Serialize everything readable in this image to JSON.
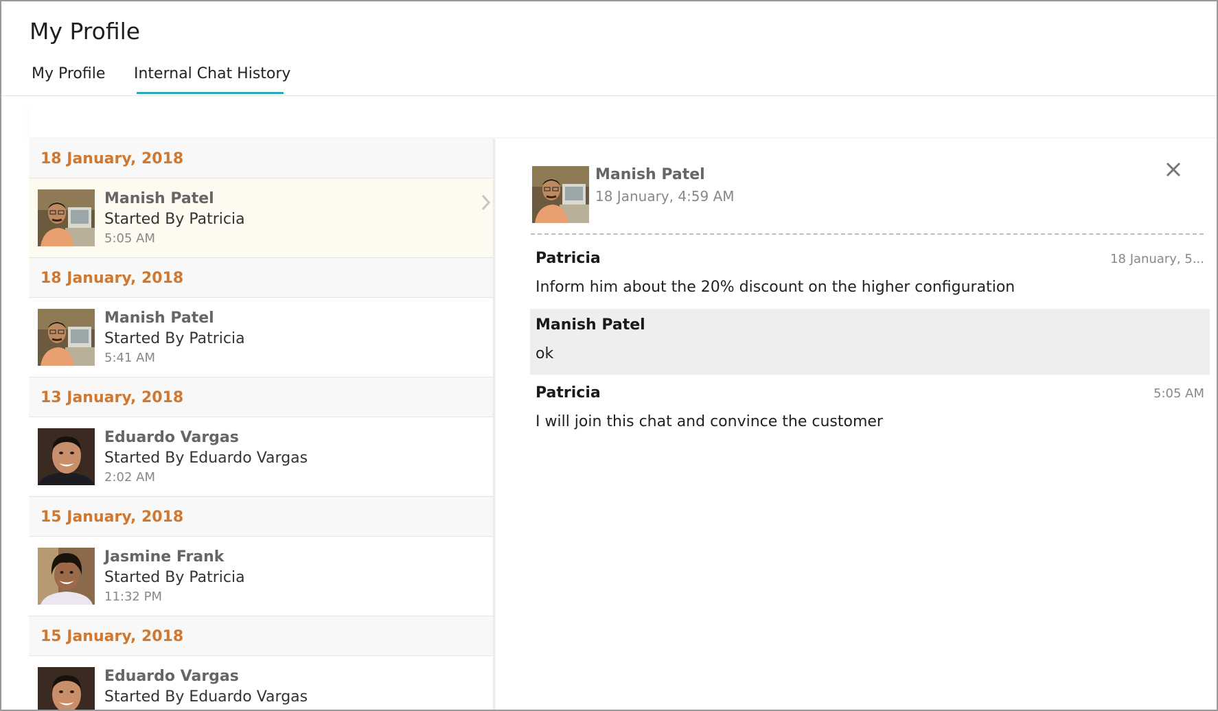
{
  "header": {
    "title": "My Profile"
  },
  "tabs": [
    {
      "label": "My Profile",
      "active": false
    },
    {
      "label": "Internal Chat History",
      "active": true
    }
  ],
  "colors": {
    "accent": "#2aa8b8",
    "date_header": "#d0782f",
    "selected_row": "#fdfbf0"
  },
  "history": [
    {
      "date": "18 January, 2018",
      "name": "Manish Patel",
      "started": "Started By Patricia",
      "time": "5:05 AM",
      "avatar": "manish-avatar",
      "selected": true
    },
    {
      "date": "18 January, 2018",
      "name": "Manish Patel",
      "started": "Started By Patricia",
      "time": "5:41 AM",
      "avatar": "manish-avatar",
      "selected": false
    },
    {
      "date": "13 January, 2018",
      "name": "Eduardo Vargas",
      "started": "Started By Eduardo Vargas",
      "time": "2:02 AM",
      "avatar": "eduardo-avatar",
      "selected": false
    },
    {
      "date": "15 January, 2018",
      "name": "Jasmine Frank",
      "started": "Started By Patricia",
      "time": "11:32 PM",
      "avatar": "jasmine-avatar",
      "selected": false
    },
    {
      "date": "15 January, 2018",
      "name": "Eduardo Vargas",
      "started": "Started By Eduardo Vargas",
      "time": "",
      "avatar": "eduardo-avatar",
      "selected": false
    }
  ],
  "detail": {
    "name": "Manish Patel",
    "date": "18 January, 4:59 AM",
    "close_icon": "close-icon",
    "messages": [
      {
        "sender": "Patricia",
        "time": "18 January, 5...",
        "text": "Inform him about the 20% discount on the higher configuration"
      },
      {
        "sender": "Manish Patel",
        "time": "",
        "text": "ok"
      },
      {
        "sender": "Patricia",
        "time": "5:05 AM",
        "text": "I will join this chat and convince the customer"
      }
    ]
  }
}
